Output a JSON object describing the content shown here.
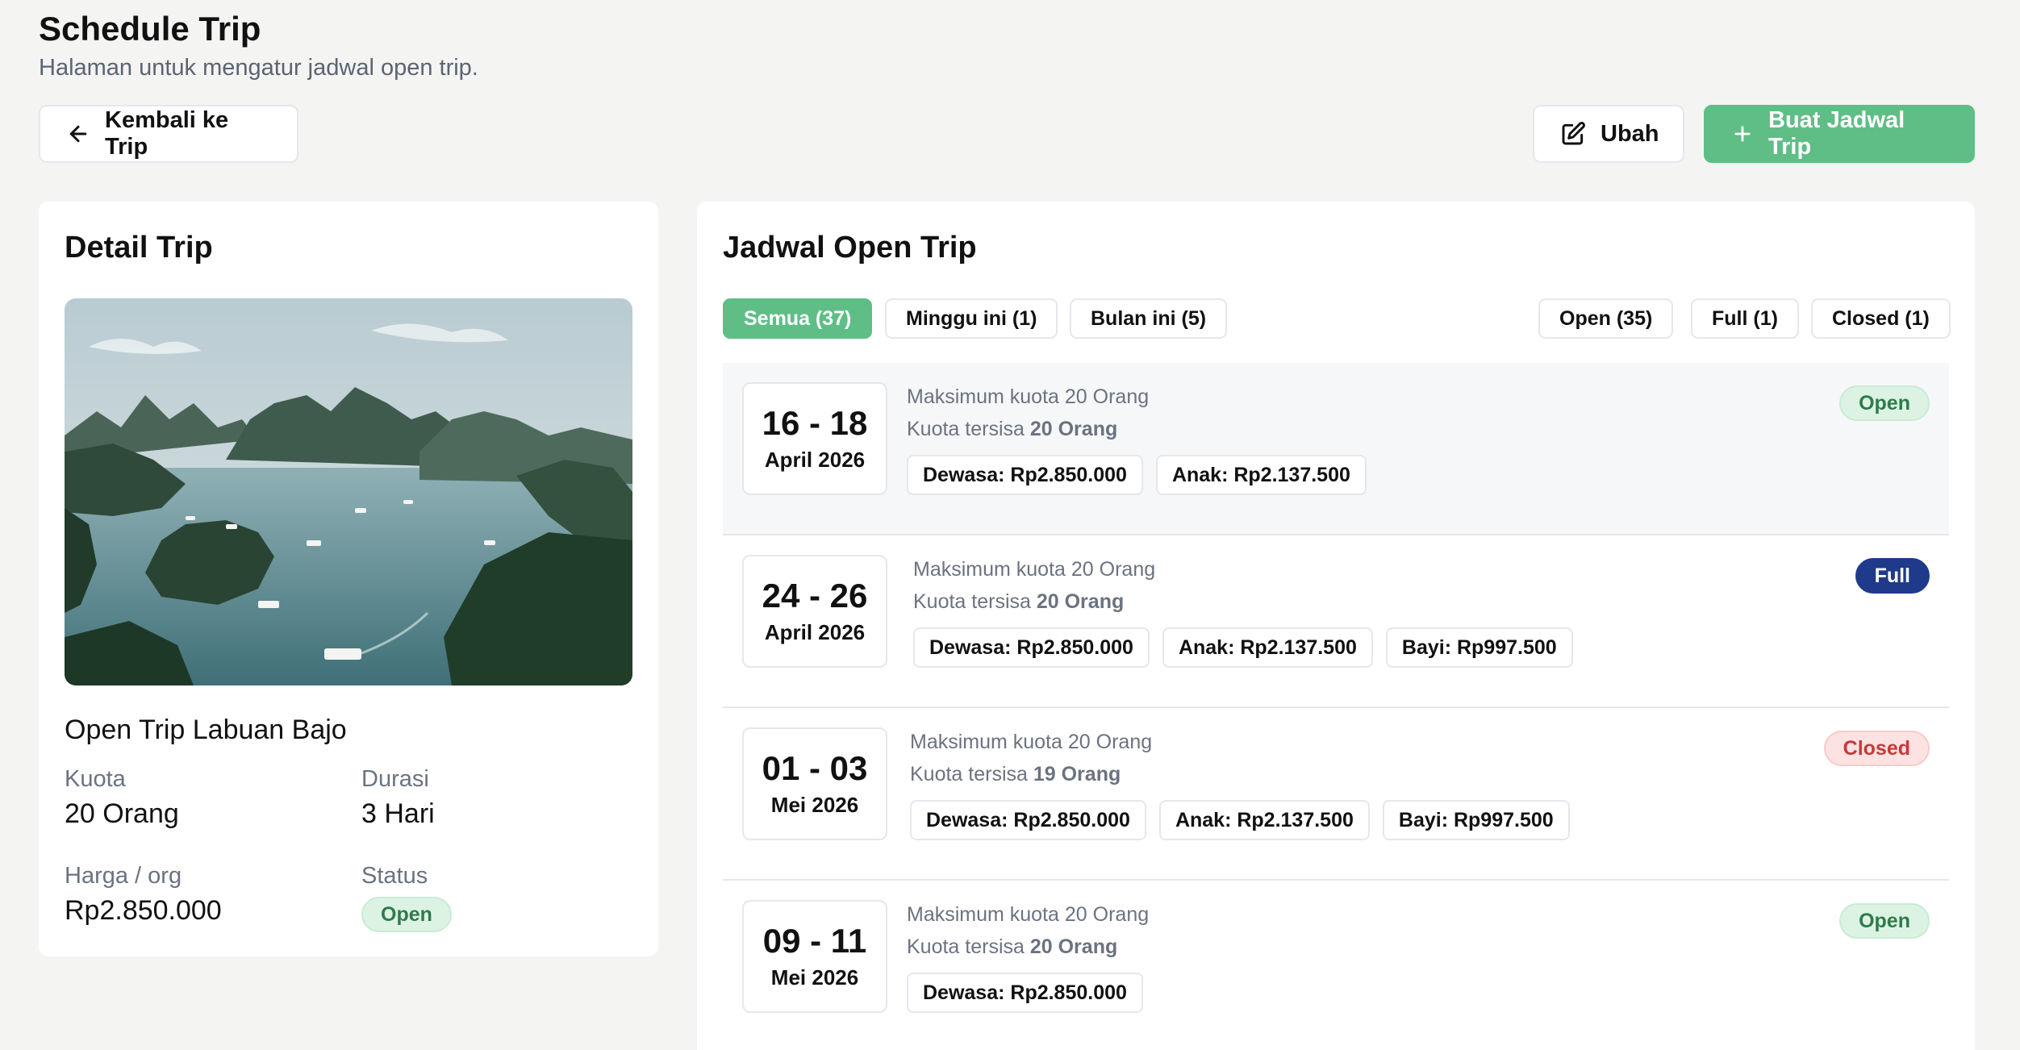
{
  "header": {
    "title": "Schedule Trip",
    "subtitle": "Halaman untuk mengatur jadwal open trip."
  },
  "toolbar": {
    "back_label": "Kembali ke Trip",
    "edit_label": "Ubah",
    "create_label": "Buat Jadwal Trip"
  },
  "detail": {
    "title": "Detail Trip",
    "trip_name": "Open Trip Labuan Bajo",
    "quota_label": "Kuota",
    "quota_value": "20 Orang",
    "duration_label": "Durasi",
    "duration_value": "3 Hari",
    "price_label": "Harga / org",
    "price_value": "Rp2.850.000",
    "status_label": "Status",
    "status_value": "Open"
  },
  "schedule": {
    "title": "Jadwal Open Trip",
    "filters_left": [
      "Semua (37)",
      "Minggu ini (1)",
      "Bulan ini (5)"
    ],
    "filters_right": [
      "Open (35)",
      "Full (1)",
      "Closed (1)"
    ],
    "rows": [
      {
        "date_range": "16 - 18",
        "month": "April 2026",
        "max_quota_text": "Maksimum kuota 20 Orang",
        "remaining_prefix": "Kuota tersisa ",
        "remaining_value": "20 Orang",
        "prices": [
          "Dewasa: Rp2.850.000",
          "Anak: Rp2.137.500"
        ],
        "status": "Open"
      },
      {
        "date_range": "24 - 26",
        "month": "April 2026",
        "max_quota_text": "Maksimum kuota 20 Orang",
        "remaining_prefix": "Kuota tersisa ",
        "remaining_value": "20 Orang",
        "prices": [
          "Dewasa: Rp2.850.000",
          "Anak: Rp2.137.500",
          "Bayi: Rp997.500"
        ],
        "status": "Full"
      },
      {
        "date_range": "01 - 03",
        "month": "Mei 2026",
        "max_quota_text": "Maksimum kuota 20 Orang",
        "remaining_prefix": "Kuota tersisa ",
        "remaining_value": "19 Orang",
        "prices": [
          "Dewasa: Rp2.850.000",
          "Anak: Rp2.137.500",
          "Bayi: Rp997.500"
        ],
        "status": "Closed"
      },
      {
        "date_range": "09 - 11",
        "month": "Mei 2026",
        "max_quota_text": "Maksimum kuota 20 Orang",
        "remaining_prefix": "Kuota tersisa ",
        "remaining_value": "20 Orang",
        "prices": [
          "Dewasa: Rp2.850.000"
        ],
        "status": "Open"
      }
    ]
  },
  "colors": {
    "accent": "#5fbe86",
    "full_badge": "#1f3a8a",
    "closed_badge_text": "#c53a3a"
  }
}
